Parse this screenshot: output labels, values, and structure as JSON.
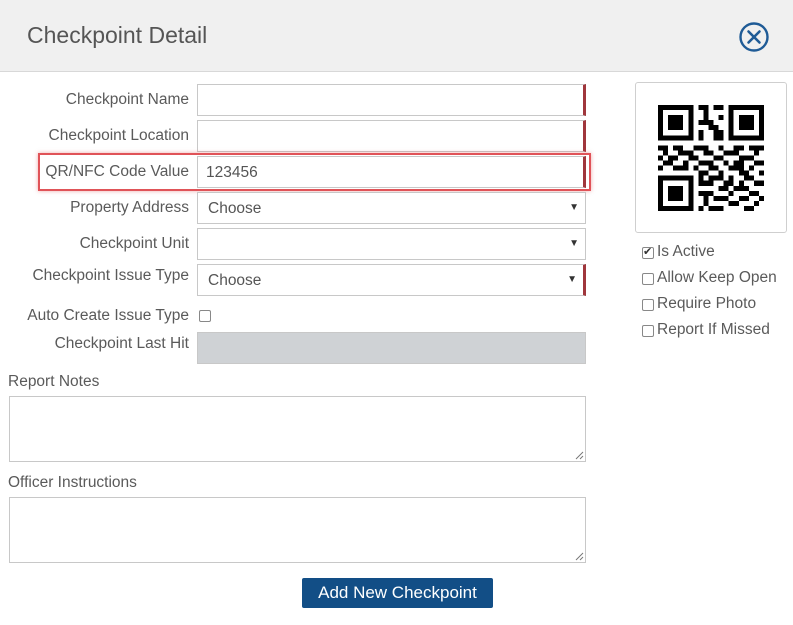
{
  "dialog": {
    "title": "Checkpoint Detail",
    "close_icon": "close-circle-icon"
  },
  "form": {
    "name_label": "Checkpoint Name",
    "name_value": "",
    "location_label": "Checkpoint Location",
    "location_value": "",
    "code_label": "QR/NFC Code Value",
    "code_value": "123456",
    "address_label": "Property Address",
    "address_value": "Choose",
    "unit_label": "Checkpoint Unit",
    "unit_value": "",
    "issue_type_label": "Checkpoint Issue Type",
    "issue_type_value": "Choose",
    "auto_create_label": "Auto Create Issue Type",
    "auto_create_checked": false,
    "last_hit_label": "Checkpoint Last Hit",
    "last_hit_value": ""
  },
  "notes": {
    "report_notes_label": "Report Notes",
    "officer_instructions_label": "Officer Instructions"
  },
  "options": [
    {
      "label": "Is Active",
      "checked": true
    },
    {
      "label": "Allow Keep Open",
      "checked": false
    },
    {
      "label": "Require Photo",
      "checked": false
    },
    {
      "label": "Report If Missed",
      "checked": false
    }
  ],
  "submit_label": "Add New Checkpoint",
  "colors": {
    "accent": "#124e86",
    "required": "#a0363c",
    "highlight": "#e05358"
  }
}
